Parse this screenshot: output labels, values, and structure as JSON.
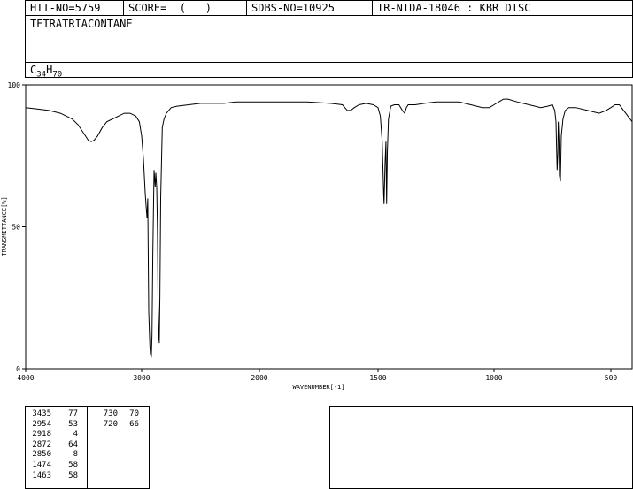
{
  "header": {
    "hit_no": "HIT-NO=5759",
    "score": "SCORE=  (   )",
    "sdbs_no": "SDBS-NO=10925",
    "ir_no": "IR-NIDA-18046 : KBR DISC",
    "compound_name": "TETRATRIACONTANE",
    "formula_c": "C",
    "formula_c_sub": "34",
    "formula_h": "H",
    "formula_h_sub": "70"
  },
  "chart_data": {
    "type": "line",
    "title": "",
    "xlabel": "WAVENUMBER[-1]",
    "ylabel": "TRANSMITTANCE[%]",
    "xlim": [
      4000,
      400
    ],
    "ylim": [
      0,
      100
    ],
    "x_ticks": [
      4000,
      3000,
      2000,
      1500,
      1000,
      500
    ],
    "y_ticks": [
      0,
      50,
      100
    ],
    "grid": false,
    "series": [
      {
        "x": [
          4000,
          3900,
          3800,
          3700,
          3600,
          3550,
          3500,
          3460,
          3435,
          3410,
          3380,
          3340,
          3300,
          3250,
          3200,
          3150,
          3100,
          3050,
          3020,
          3000,
          2985,
          2970,
          2962,
          2954,
          2948,
          2940,
          2930,
          2925,
          2918,
          2912,
          2905,
          2895,
          2885,
          2880,
          2872,
          2866,
          2860,
          2855,
          2850,
          2845,
          2838,
          2825,
          2810,
          2790,
          2770,
          2750,
          2700,
          2600,
          2500,
          2400,
          2300,
          2200,
          2100,
          2000,
          1900,
          1800,
          1700,
          1650,
          1630,
          1615,
          1600,
          1580,
          1550,
          1520,
          1500,
          1490,
          1482,
          1476,
          1474,
          1470,
          1466,
          1463,
          1460,
          1455,
          1445,
          1430,
          1410,
          1395,
          1385,
          1378,
          1370,
          1360,
          1340,
          1300,
          1250,
          1200,
          1150,
          1100,
          1050,
          1020,
          1000,
          980,
          960,
          940,
          900,
          850,
          800,
          770,
          750,
          740,
          735,
          733,
          730,
          727,
          725,
          722,
          720,
          716,
          712,
          705,
          695,
          680,
          650,
          600,
          550,
          520,
          500,
          480,
          460,
          440,
          430,
          420,
          410,
          400
        ],
        "y": [
          92,
          91.5,
          91,
          90,
          88,
          86,
          83,
          80.5,
          80,
          80.5,
          82,
          85,
          87,
          88,
          89,
          90,
          90,
          89,
          87,
          82,
          74,
          62,
          57,
          53,
          60,
          20,
          8,
          5,
          4,
          12,
          40,
          70,
          64,
          69,
          64,
          50,
          22,
          12,
          9,
          25,
          60,
          85,
          88,
          90,
          91,
          92,
          92.5,
          93,
          93.5,
          93.5,
          93.5,
          94,
          94,
          94,
          94,
          94,
          93.5,
          93,
          91,
          91,
          92,
          93,
          93.5,
          93,
          92,
          89,
          80,
          62,
          58,
          72,
          80,
          58,
          76,
          88,
          92.5,
          93,
          93,
          91,
          90,
          92,
          93,
          93,
          93,
          93.5,
          94,
          94,
          94,
          93,
          92,
          92,
          93,
          94,
          95,
          95,
          94,
          93,
          92,
          92.5,
          93,
          91,
          87,
          80,
          70,
          76,
          87,
          80,
          68,
          66,
          82,
          88,
          91,
          92,
          92,
          91,
          90,
          91,
          92,
          93,
          93,
          91,
          90,
          89,
          88,
          87
        ]
      }
    ]
  },
  "peak_table": {
    "col1": [
      {
        "wavenumber": "3435",
        "transmittance": "77"
      },
      {
        "wavenumber": "2954",
        "transmittance": "53"
      },
      {
        "wavenumber": "2918",
        "transmittance": "4"
      },
      {
        "wavenumber": "2872",
        "transmittance": "64"
      },
      {
        "wavenumber": "2850",
        "transmittance": "8"
      },
      {
        "wavenumber": "1474",
        "transmittance": "58"
      },
      {
        "wavenumber": "1463",
        "transmittance": "58"
      }
    ],
    "col2": [
      {
        "wavenumber": "730",
        "transmittance": "70"
      },
      {
        "wavenumber": "720",
        "transmittance": "66"
      }
    ]
  }
}
